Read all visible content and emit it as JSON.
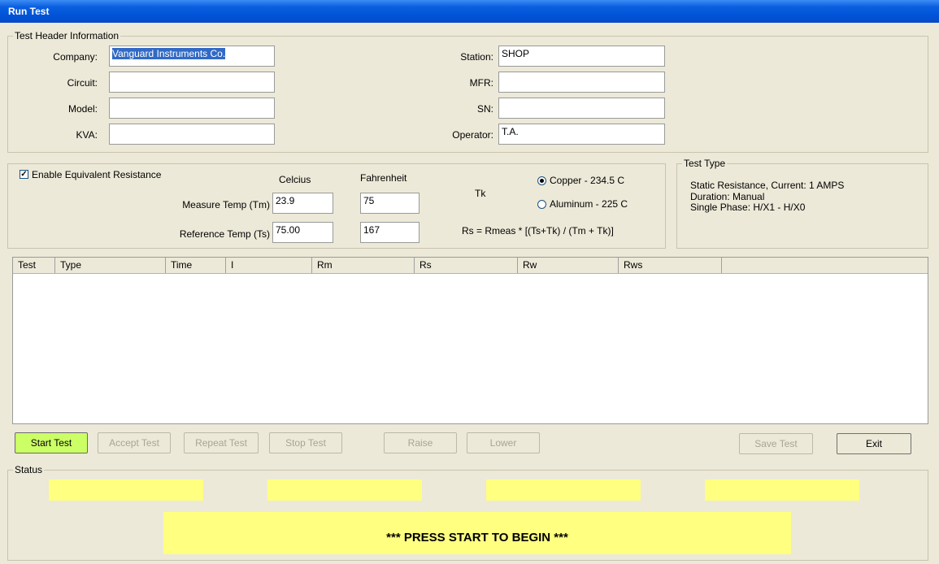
{
  "window": {
    "title": "Run Test"
  },
  "header_group": {
    "title": "Test Header Information",
    "left_fields": [
      {
        "label": "Company:",
        "value": "Vanguard Instruments Co."
      },
      {
        "label": "Circuit:",
        "value": ""
      },
      {
        "label": "Model:",
        "value": ""
      },
      {
        "label": "KVA:",
        "value": ""
      }
    ],
    "right_fields": [
      {
        "label": "Station:",
        "value": "SHOP"
      },
      {
        "label": "MFR:",
        "value": ""
      },
      {
        "label": "SN:",
        "value": ""
      },
      {
        "label": "Operator:",
        "value": "T.A."
      }
    ]
  },
  "equiv_group": {
    "enable_label": "Enable Equivalent Resistance",
    "enable_checked": true,
    "col_celcius": "Celcius",
    "col_fahrenheit": "Fahrenheit",
    "measure_label": "Measure Temp (Tm)",
    "measure_c": "23.9",
    "measure_f": "75",
    "reference_label": "Reference Temp (Ts)",
    "reference_c": "75.00",
    "reference_f": "167",
    "tk_label": "Tk",
    "copper_label": "Copper - 234.5 C",
    "aluminum_label": "Aluminum - 225 C",
    "selected_material": "copper",
    "formula": "Rs = Rmeas * [(Ts+Tk) / (Tm + Tk)]"
  },
  "test_type_group": {
    "title": "Test Type",
    "line1": "Static Resistance, Current: 1 AMPS",
    "line2": "Duration: Manual",
    "line3": "Single Phase: H/X1 - H/X0"
  },
  "table": {
    "columns": [
      "Test",
      "Type",
      "Time",
      "I",
      "Rm",
      "Rs",
      "Rw",
      "Rws"
    ],
    "rows": []
  },
  "buttons": {
    "start": "Start Test",
    "accept": "Accept Test",
    "repeat": "Repeat Test",
    "stop": "Stop Test",
    "raise": "Raise",
    "lower": "Lower",
    "save": "Save Test",
    "exit": "Exit"
  },
  "status": {
    "title": "Status",
    "boxes": [
      "",
      "",
      "",
      ""
    ],
    "message": "*** PRESS START TO BEGIN ***",
    "highlight_color": "#ffff80"
  },
  "colors": {
    "start_button": "#ccff66",
    "selection": "#316ac5"
  }
}
